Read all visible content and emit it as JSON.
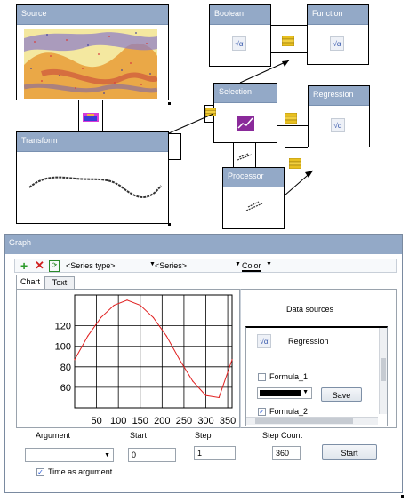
{
  "nodes": {
    "source": {
      "title": "Source"
    },
    "transform": {
      "title": "Transform"
    },
    "boolean": {
      "title": "Boolean"
    },
    "function": {
      "title": "Function"
    },
    "selection": {
      "title": "Selection"
    },
    "regression": {
      "title": "Regression"
    },
    "processor": {
      "title": "Processor"
    }
  },
  "graph_window": {
    "title": "Graph",
    "toolbar": {
      "series_type_placeholder": "<Series type>",
      "series_placeholder": "<Series>",
      "color_label": "Color",
      "icons": [
        "add-icon",
        "delete-icon",
        "refresh-icon"
      ]
    },
    "tabs": [
      {
        "label": "Chart"
      },
      {
        "label": "Text"
      }
    ],
    "data_sources": {
      "title": "Data sources",
      "item": "Regression",
      "formula_1": {
        "label": "Formula_1",
        "checked": false
      },
      "formula_2": {
        "label": "Formula_2",
        "checked": true
      },
      "save_label": "Save",
      "swatch_color": "#000000"
    },
    "argument_label": "Argument",
    "start_label": "Start",
    "start_value": "0",
    "step_label": "Step",
    "step_value": "1",
    "step_count_label": "Step Count",
    "step_count_value": "360",
    "start_button": "Start",
    "time_as_argument": {
      "label": "Time as argument",
      "checked": true
    }
  },
  "chart_data": {
    "type": "line",
    "x_ticks": [
      "50",
      "100",
      "150",
      "200",
      "250",
      "300",
      "350"
    ],
    "y_ticks": [
      "120",
      "100",
      "80",
      "60"
    ],
    "xlim": [
      0,
      360
    ],
    "ylim": [
      40,
      150
    ],
    "grid": true,
    "series": [
      {
        "color": "#e02020",
        "x": [
          0,
          30,
          60,
          90,
          120,
          150,
          180,
          210,
          240,
          270,
          300,
          330,
          360
        ],
        "y": [
          87,
          110,
          128,
          140,
          145,
          140,
          128,
          110,
          87,
          66,
          52,
          50,
          87
        ]
      }
    ]
  }
}
